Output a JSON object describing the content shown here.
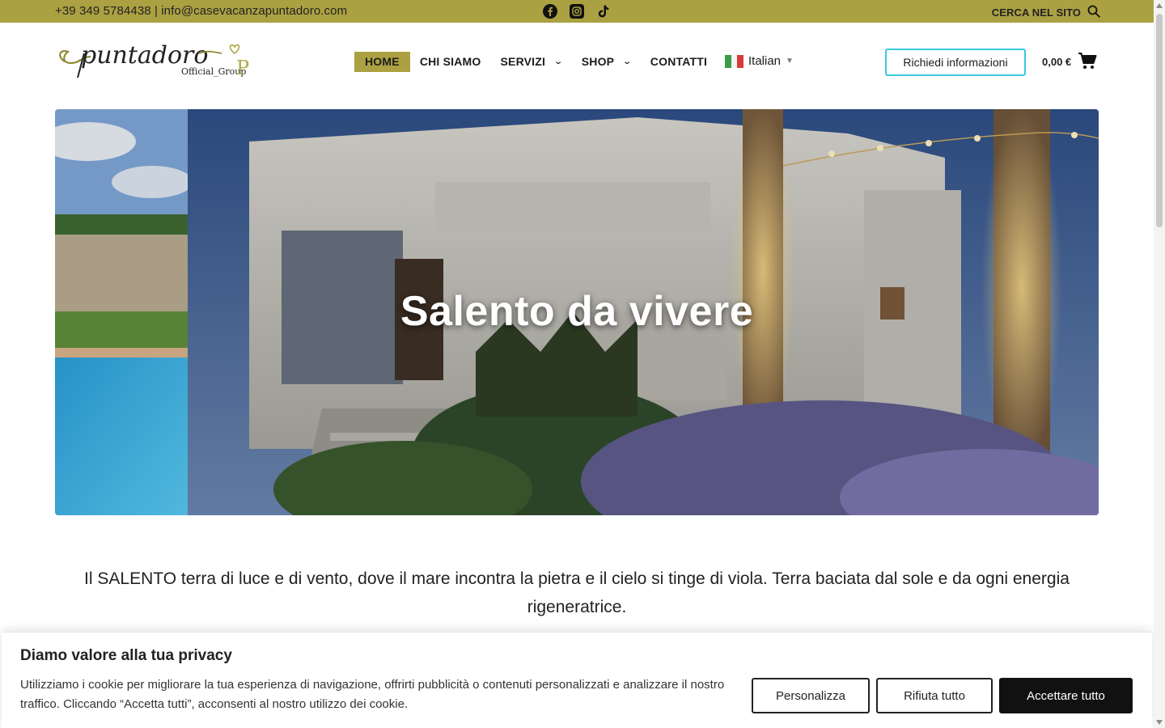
{
  "topbar": {
    "contact": "+39 349 5784438 | info@casevacanzapuntadoro.com",
    "social_icons": [
      "facebook-icon",
      "instagram-icon",
      "tiktok-icon"
    ],
    "search_label": "CERCA NEL SITO"
  },
  "header": {
    "logo_text": "puntadoro",
    "logo_subtext": "Official_Group",
    "nav": [
      {
        "label": "HOME",
        "active": true
      },
      {
        "label": "CHI SIAMO"
      },
      {
        "label": "SERVIZI",
        "has_dropdown": true
      },
      {
        "label": "SHOP",
        "has_dropdown": true
      },
      {
        "label": "CONTATTI"
      }
    ],
    "language": "Italian",
    "cta_label": "Richiedi informazioni",
    "cart_total": "0,00 €"
  },
  "hero": {
    "title": "Salento da vivere"
  },
  "intro": {
    "text": "Il SALENTO terra di luce e di vento, dove il mare incontra la pietra e il cielo si tinge di viola. Terra baciata dal sole e da ogni energia rigeneratrice."
  },
  "cookie": {
    "title": "Diamo valore alla tua privacy",
    "text": "Utilizziamo i cookie per migliorare la tua esperienza di navigazione, offrirti pubblicità o contenuti personalizzati e analizzare il nostro traffico. Cliccando “Accetta tutti”, acconsenti al nostro utilizzo dei cookie.",
    "customize_label": "Personalizza",
    "reject_label": "Rifiuta tutto",
    "accept_label": "Accettare tutto"
  },
  "colors": {
    "brand_olive": "#aca142",
    "cta_border": "#3cc8d8",
    "accept_bg": "#111111"
  }
}
